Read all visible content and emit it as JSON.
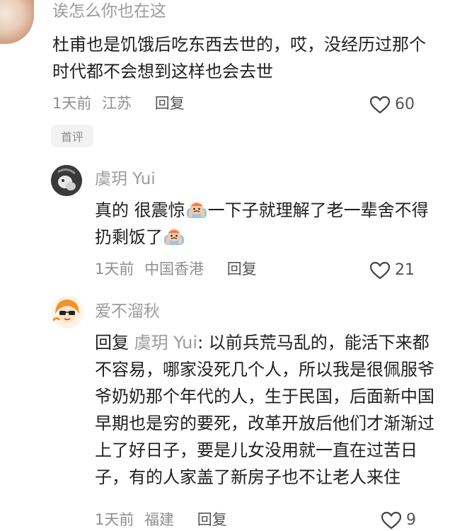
{
  "comments": [
    {
      "username": "诶怎么你也在这",
      "lines": [
        "杜甫也是饥饿后吃东西去世的，哎，没经历过那个",
        "时代都不会想到这样也会去世"
      ],
      "time": "1天前",
      "location": "江苏",
      "reply_label": "回复",
      "likes": "60",
      "badge": "首评"
    },
    {
      "username": "虞玥 Yui",
      "line1_a": "真的 很震惊",
      "line1_b": "一下子就理解了老一辈舍不得",
      "line2": "扔剩饭了",
      "time": "1天前",
      "location": "中国香港",
      "reply_label": "回复",
      "likes": "21"
    },
    {
      "username": "爱不溜秋",
      "reply_prefix": "回复",
      "reply_to": "虞玥 Yui",
      "line1_rest": ": 以前兵荒马乱的，能活下来都",
      "lines": [
        "不容易，哪家没死几个人，所以我是很佩服爷",
        "爷奶奶那个年代的人，生于民国，后面新中国",
        "早期也是穷的要死，改革开放后他们才渐渐过",
        "上了好日子，要是儿女没用就一直在过苦日",
        "子，有的人家盖了新房子也不让老人来住"
      ],
      "time": "1天前",
      "location": "福建",
      "reply_label": "回复",
      "likes": "9"
    }
  ]
}
